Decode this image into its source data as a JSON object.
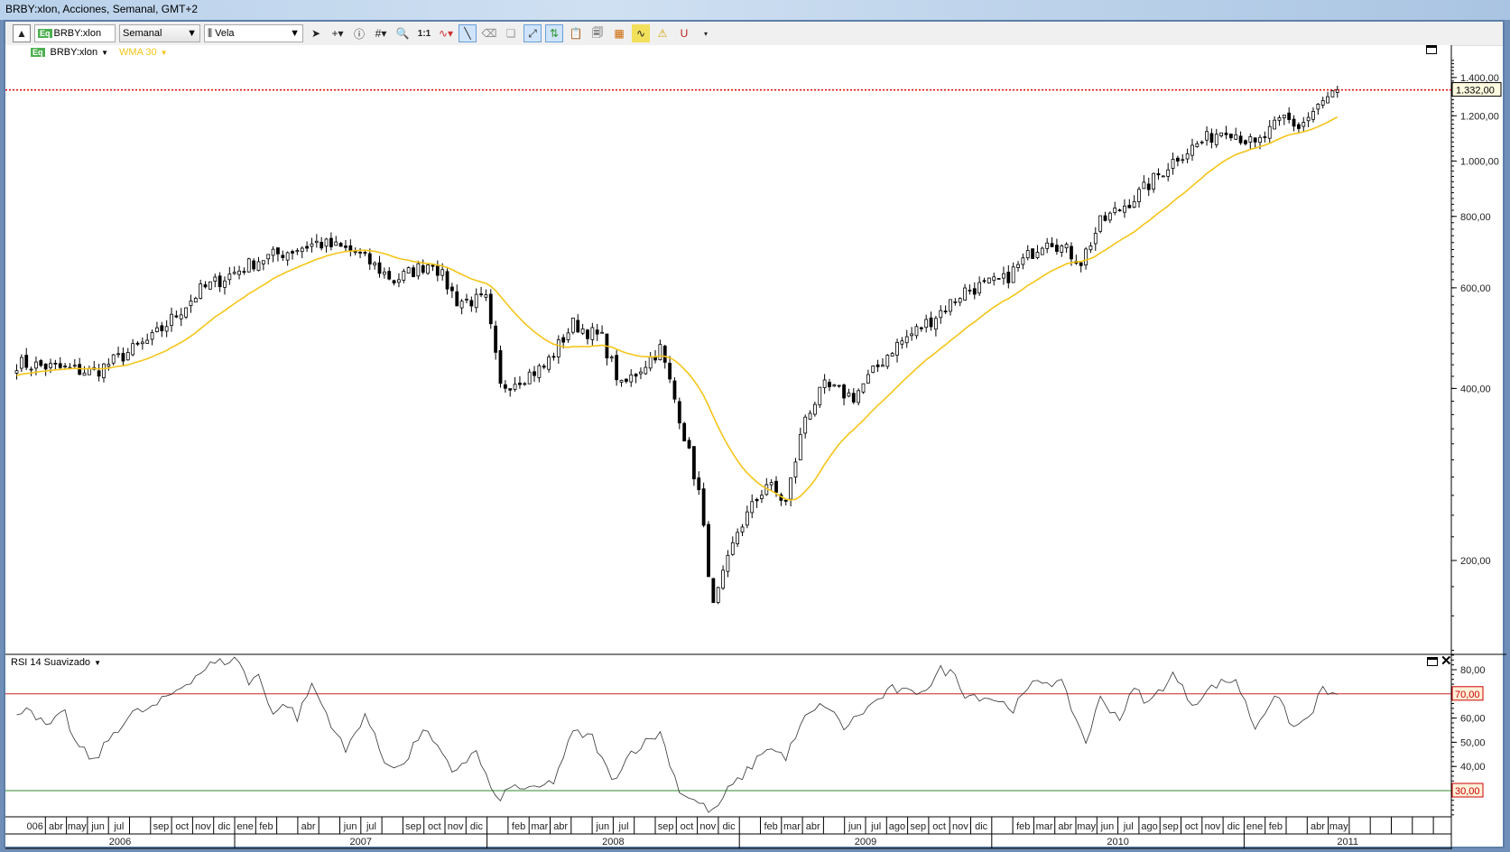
{
  "window": {
    "title": "BRBY:xlon, Acciones, Semanal, GMT+2"
  },
  "toolbar": {
    "symbol": "BRBY:xlon",
    "symbol_badge": "Eq",
    "period": "Semanal",
    "chart_type": "Vela",
    "one_to_one": "1:1"
  },
  "legend": {
    "symbol": "BRBY:xlon",
    "badge": "Eq",
    "indicator": "WMA 30",
    "wma_color": "#f5c518"
  },
  "rsi_panel": {
    "title": "RSI 14 Suavizado",
    "upper_level_label": "70,00",
    "lower_level_label": "30,00",
    "upper_color": "#cc2222",
    "lower_color": "#2e8b2e"
  },
  "price_axis": {
    "labels": [
      "1.400,00",
      "1.200,00",
      "1.000,00",
      "800,00",
      "600,00",
      "400,00",
      "200,00"
    ],
    "last_price_label": "1.332,00"
  },
  "rsi_axis": {
    "labels": [
      "80,00",
      "60,00",
      "50,00",
      "40,00"
    ]
  },
  "time_axis": {
    "months": [
      "006",
      "abr",
      "may",
      "jun",
      "jul",
      "",
      "sep",
      "oct",
      "nov",
      "dic",
      "ene",
      "feb",
      "",
      "abr",
      "",
      "jun",
      "jul",
      "",
      "sep",
      "oct",
      "nov",
      "dic",
      "",
      "feb",
      "mar",
      "abr",
      "",
      "jun",
      "jul",
      "",
      "sep",
      "oct",
      "nov",
      "dic",
      "",
      "feb",
      "mar",
      "abr",
      "",
      "jun",
      "jul",
      "ago",
      "sep",
      "oct",
      "nov",
      "dic",
      "",
      "feb",
      "mar",
      "abr",
      "may",
      "jun",
      "jul",
      "ago",
      "sep",
      "oct",
      "nov",
      "dic",
      "ene",
      "feb",
      "",
      "abr",
      "may",
      "",
      "",
      "",
      "",
      ""
    ],
    "years": [
      "2006",
      "2007",
      "2008",
      "2009",
      "2010",
      "2011"
    ]
  },
  "chart_data": {
    "type": "candlestick",
    "frequency": "weekly",
    "title": "BRBY:xlon, Acciones, Semanal",
    "price_scale": "log",
    "price_range": [
      150,
      1500
    ],
    "last_price": 1332,
    "close_keypoints_week_value": [
      [
        0,
        443
      ],
      [
        16,
        427
      ],
      [
        28,
        489
      ],
      [
        38,
        594
      ],
      [
        50,
        672
      ],
      [
        62,
        719
      ],
      [
        70,
        694
      ],
      [
        78,
        618
      ],
      [
        86,
        668
      ],
      [
        91,
        570
      ],
      [
        97,
        570
      ],
      [
        100,
        402
      ],
      [
        109,
        436
      ],
      [
        115,
        519
      ],
      [
        121,
        489
      ],
      [
        125,
        402
      ],
      [
        133,
        470
      ],
      [
        137,
        358
      ],
      [
        141,
        263
      ],
      [
        144,
        165
      ],
      [
        149,
        225
      ],
      [
        155,
        273
      ],
      [
        159,
        252
      ],
      [
        163,
        358
      ],
      [
        167,
        402
      ],
      [
        173,
        387
      ],
      [
        181,
        470
      ],
      [
        189,
        528
      ],
      [
        196,
        594
      ],
      [
        204,
        618
      ],
      [
        213,
        736
      ],
      [
        220,
        668
      ],
      [
        224,
        779
      ],
      [
        232,
        876
      ],
      [
        240,
        1020
      ],
      [
        250,
        1146
      ],
      [
        256,
        1062
      ],
      [
        262,
        1192
      ],
      [
        265,
        1146
      ],
      [
        269,
        1241
      ],
      [
        273,
        1332
      ]
    ],
    "overlay": {
      "name": "WMA 30",
      "period": 30
    },
    "rsi": {
      "name": "RSI 14 Suavizado",
      "range": [
        15,
        90
      ],
      "levels": [
        70,
        30
      ],
      "keypoints_week_value": [
        [
          0,
          60
        ],
        [
          2,
          66
        ],
        [
          6,
          56
        ],
        [
          10,
          62
        ],
        [
          12,
          50
        ],
        [
          16,
          42
        ],
        [
          20,
          54
        ],
        [
          24,
          62
        ],
        [
          28,
          64
        ],
        [
          32,
          70
        ],
        [
          36,
          76
        ],
        [
          40,
          82
        ],
        [
          44,
          84
        ],
        [
          46,
          84
        ],
        [
          48,
          74
        ],
        [
          50,
          78
        ],
        [
          53,
          62
        ],
        [
          56,
          66
        ],
        [
          58,
          60
        ],
        [
          61,
          74
        ],
        [
          64,
          62
        ],
        [
          68,
          46
        ],
        [
          72,
          62
        ],
        [
          76,
          42
        ],
        [
          80,
          40
        ],
        [
          84,
          56
        ],
        [
          90,
          38
        ],
        [
          95,
          46
        ],
        [
          99,
          26
        ],
        [
          103,
          32
        ],
        [
          107,
          30
        ],
        [
          111,
          34
        ],
        [
          115,
          54
        ],
        [
          119,
          52
        ],
        [
          123,
          34
        ],
        [
          127,
          46
        ],
        [
          133,
          54
        ],
        [
          137,
          30
        ],
        [
          140,
          26
        ],
        [
          144,
          21
        ],
        [
          147,
          30
        ],
        [
          151,
          38
        ],
        [
          155,
          48
        ],
        [
          159,
          44
        ],
        [
          163,
          60
        ],
        [
          167,
          66
        ],
        [
          171,
          56
        ],
        [
          177,
          66
        ],
        [
          181,
          72
        ],
        [
          185,
          70
        ],
        [
          189,
          74
        ],
        [
          191,
          80
        ],
        [
          194,
          78
        ],
        [
          196,
          70
        ],
        [
          202,
          68
        ],
        [
          206,
          64
        ],
        [
          211,
          76
        ],
        [
          216,
          74
        ],
        [
          221,
          50
        ],
        [
          224,
          68
        ],
        [
          228,
          60
        ],
        [
          231,
          72
        ],
        [
          234,
          66
        ],
        [
          239,
          78
        ],
        [
          243,
          66
        ],
        [
          248,
          74
        ],
        [
          252,
          76
        ],
        [
          256,
          56
        ],
        [
          260,
          70
        ],
        [
          264,
          56
        ],
        [
          267,
          60
        ],
        [
          270,
          72
        ],
        [
          273,
          68
        ]
      ]
    }
  }
}
